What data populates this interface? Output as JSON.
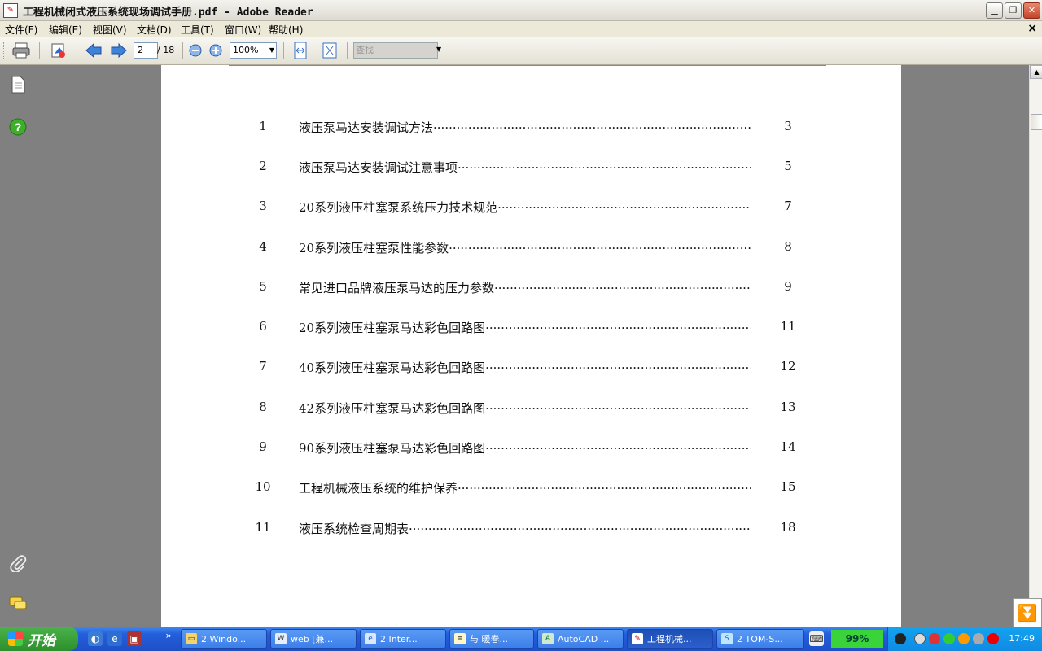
{
  "window": {
    "title": "工程机械闭式液压系统现场调试手册.pdf - Adobe Reader",
    "app_icon": "pdf-icon"
  },
  "menu": [
    "文件(F)",
    "编辑(E)",
    "视图(V)",
    "文档(D)",
    "工具(T)",
    "窗口(W)",
    "帮助(H)"
  ],
  "toolbar": {
    "page_current": "2",
    "page_total": "/ 18",
    "zoom": "100%",
    "find_placeholder": "查找"
  },
  "document": {
    "toc": [
      {
        "num": "1",
        "title": "液压泵马达安装调试方法",
        "page": "3"
      },
      {
        "num": "2",
        "title": "液压泵马达安装调试注意事项",
        "page": "5"
      },
      {
        "num": "3",
        "title": "20系列液压柱塞泵系统压力技术规范",
        "page": "7"
      },
      {
        "num": "4",
        "title": "20系列液压柱塞泵性能参数",
        "page": "8"
      },
      {
        "num": "5",
        "title": "常见进口品牌液压泵马达的压力参数",
        "page": "9"
      },
      {
        "num": "6",
        "title": "20系列液压柱塞泵马达彩色回路图",
        "page": "11"
      },
      {
        "num": "7",
        "title": "40系列液压柱塞泵马达彩色回路图",
        "page": "12"
      },
      {
        "num": "8",
        "title": "42系列液压柱塞泵马达彩色回路图",
        "page": "13"
      },
      {
        "num": "9",
        "title": "90系列液压柱塞泵马达彩色回路图",
        "page": "14"
      },
      {
        "num": "10",
        "title": "工程机械液压系统的维护保养",
        "page": "15"
      },
      {
        "num": "11",
        "title": "液压系统检查周期表",
        "page": "18"
      }
    ]
  },
  "taskbar": {
    "start_label": "开始",
    "tasks": [
      {
        "label": "2 Windo...",
        "icon": "folder-icon"
      },
      {
        "label": "web [兼...",
        "icon": "word-icon"
      },
      {
        "label": "2 Inter...",
        "icon": "ie-icon"
      },
      {
        "label": "与 暖春...",
        "icon": "notepad-icon"
      },
      {
        "label": "AutoCAD ...",
        "icon": "autocad-icon"
      },
      {
        "label": "工程机械...",
        "icon": "pdf-icon"
      },
      {
        "label": "2 TOM-S...",
        "icon": "skype-icon"
      }
    ],
    "battery": "99%",
    "clock": "17:49"
  }
}
